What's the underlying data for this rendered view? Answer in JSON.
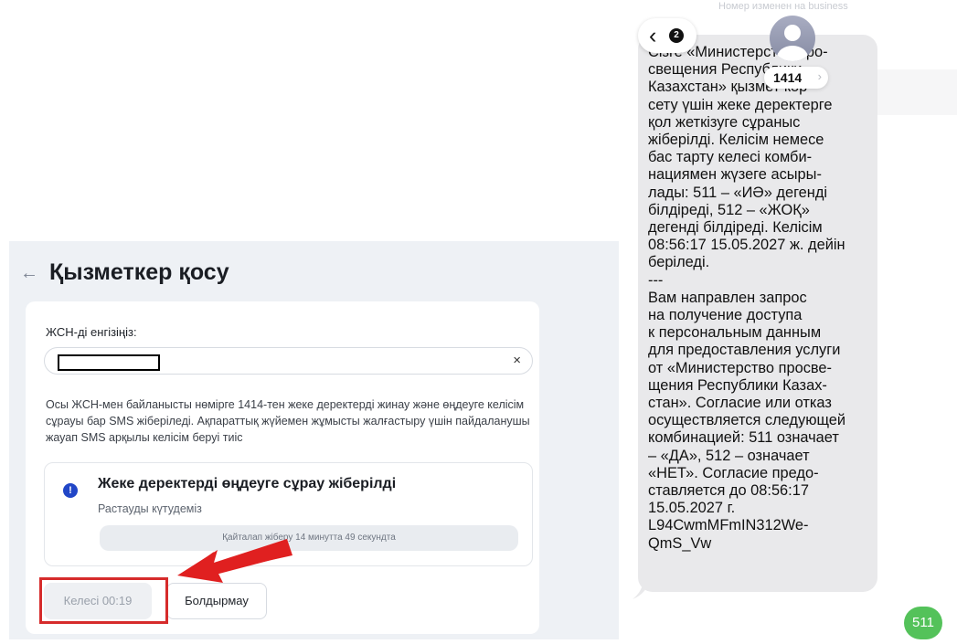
{
  "form": {
    "back_icon": "arrow-left-icon",
    "title": "Қызметкер қосу",
    "iin_label": "ЖСН-ді енгізіңіз:",
    "iin_value": "",
    "clear_icon": "×",
    "info_text": "Осы ЖСН-мен байланысты нөмірге 1414-тен жеке деректерді жинау және өңдеуге келісім сұрауы бар SMS жіберіледі. Ақпараттық жүйемен жұмысты жалғастыру үшін пайдаланушы жауап SMS арқылы келісім беруі тиіс",
    "status": {
      "icon": "info-icon",
      "title": "Жеке деректерді өңдеуге сұрау жіберілді",
      "subtitle": "Растауды күтудеміз",
      "resend_text": "Қайталап жіберу 14 минутта 49 секундта"
    },
    "next_button": "Келесі 00:19",
    "cancel_button": "Болдырмау"
  },
  "sms": {
    "top_banner": "Номер изменен на business",
    "back_badge_count": "2",
    "contact_name": "1414",
    "message": "Сізге «Министерство про-\nсвещения Республики\nКазахстан» қызмет көр-\nсету үшін жеке деректерге\nқол жеткізуге сұраныс\nжіберілді. Келісім немесе\nбас тарту келесі комби-\nнациямен жүзеге асыры-\nлады: 511 – «ИӘ» дегенді\nбілдіреді, 512 – «ЖОҚ»\nдегенді білдіреді. Келісім\n08:56:17 15.05.2027 ж. дейін\nберіледі.\n---\nВам направлен запрос\nна получение доступа\nк персональным данным\nдля предоставления услуги\nот «Министерство просве-\nщения Республики Казах-\nстан». Согласие или отказ\nосуществляется следующей\nкомбинацией: 511 означает\n– «ДА», 512 – означает\n«НЕТ». Согласие предо-\nставляется до 08:56:17\n15.05.2027 г.\nL94CwmMFmIN312We-\nQmS_Vw",
    "reply": "511"
  },
  "colors": {
    "accent_blue": "#2146c7",
    "highlight_red": "#d62b2b",
    "reply_green": "#54c25a"
  }
}
